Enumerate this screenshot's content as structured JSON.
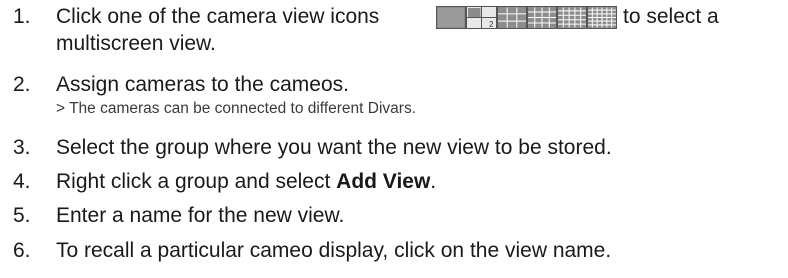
{
  "steps": [
    {
      "number": "1.",
      "text_before": "Click one of the camera view icons",
      "text_after": "to select a",
      "text_continued": "multiscreen view.",
      "icons": [
        "single-view-icon",
        "quad-view-icon",
        "nine-view-icon",
        "sixteen-view-icon",
        "twentyfive-view-icon",
        "thirtysix-view-icon"
      ],
      "quad_view_digit": "2"
    },
    {
      "number": "2.",
      "text": "Assign cameras to the cameos.",
      "note": "> The cameras can be connected to different Divars."
    },
    {
      "number": "3.",
      "text": "Select the group where you want the new view to be stored."
    },
    {
      "number": "4.",
      "text_before": "Right click a group and select ",
      "text_bold": "Add View",
      "text_after": "."
    },
    {
      "number": "5.",
      "text": "Enter a name for the new view."
    },
    {
      "number": "6.",
      "text": "To recall a particular cameo display, click on the view name."
    }
  ],
  "colors": {
    "text": "#1a1a1a",
    "note_text": "#3a3a3a",
    "icon_fill": "#8c8c8c",
    "icon_grid_line": "#ffffff",
    "icon_border": "#555555"
  }
}
